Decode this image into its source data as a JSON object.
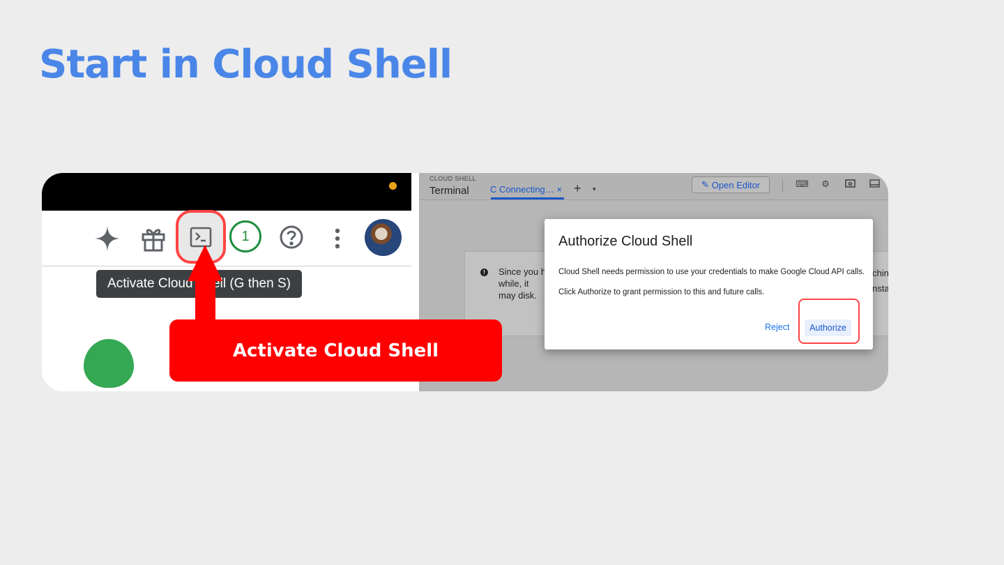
{
  "slide": {
    "title": "Start in Cloud Shell"
  },
  "left": {
    "tooltip": "Activate Cloud Shell (G then S)",
    "notification_count": "1",
    "callout": "Activate Cloud Shell"
  },
  "cloud_shell": {
    "header_small": "CLOUD SHELL",
    "header_title": "Terminal",
    "tab_label": "Connecting…",
    "tab_close": "×",
    "add_tab": "+",
    "tab_menu": "▾",
    "open_editor": "Open Editor",
    "info_text": "Since you h while, it may disk.",
    "info_right": "chin nstar"
  },
  "dialog": {
    "title": "Authorize Cloud Shell",
    "body_line1": "Cloud Shell needs permission to use your credentials to make Google Cloud API calls.",
    "body_line2": "Click Authorize to grant permission to this and future calls.",
    "reject_label": "Reject",
    "authorize_label": "Authorize"
  },
  "colors": {
    "title_blue": "#4a86e8",
    "callout_red": "#ff0000",
    "link_blue": "#1a73e8"
  }
}
